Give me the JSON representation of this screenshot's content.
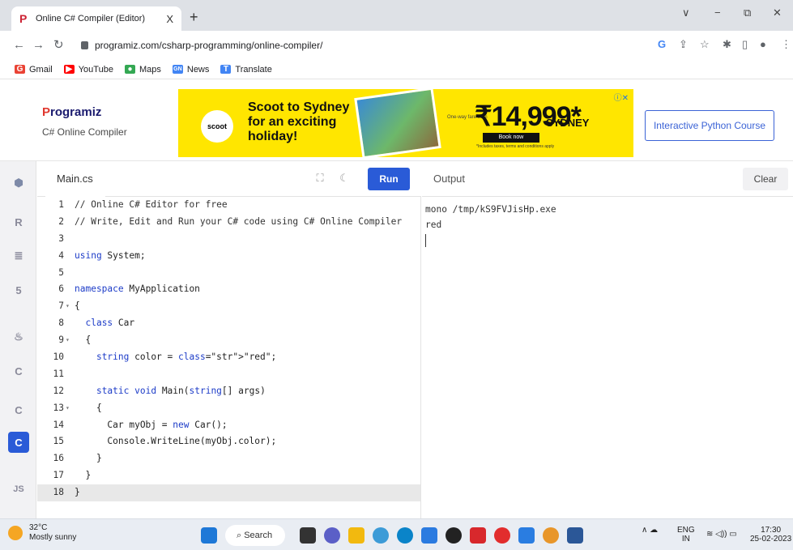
{
  "browser": {
    "tab_title": "Online C# Compiler (Editor)",
    "tab_close": "X",
    "new_tab": "+",
    "url": "programiz.com/csharp-programming/online-compiler/",
    "window_controls": [
      "∨",
      "−",
      "⧉",
      "✕"
    ]
  },
  "bookmarks": [
    {
      "label": "Gmail",
      "icon": "gmail-icon",
      "color": "#ea4335",
      "glyph": "G"
    },
    {
      "label": "YouTube",
      "icon": "youtube-icon",
      "color": "#ff0000",
      "glyph": "▶"
    },
    {
      "label": "Maps",
      "icon": "maps-icon",
      "color": "#34a853",
      "glyph": "●"
    },
    {
      "label": "News",
      "icon": "news-icon",
      "color": "#4285f4",
      "glyph": "GN"
    },
    {
      "label": "Translate",
      "icon": "translate-icon",
      "color": "#4285f4",
      "glyph": "T"
    }
  ],
  "header": {
    "logo": "rogramiz",
    "logo_mark": "P",
    "subtitle": "C# Online Compiler",
    "python_course_button": "Interactive Python Course"
  },
  "ad": {
    "brand": "scoot",
    "headline": "Scoot to Sydney for an exciting holiday!",
    "one_way": "One-way fare from",
    "price": "₹14,999*",
    "book_now": "Book now",
    "fine_print": "*Includes taxes, terms and conditions apply",
    "destination": "SYDNEY"
  },
  "sidebar": {
    "items": [
      "python-icon",
      "r-icon",
      "sql-icon",
      "html-icon",
      "java-icon",
      "c-icon",
      "cpp-icon",
      "csharp-icon",
      "js-icon"
    ],
    "js_label": "JS",
    "active": "csharp-icon"
  },
  "editor": {
    "file_name": "Main.cs",
    "run_label": "Run",
    "lines": [
      {
        "n": "1",
        "fold": "",
        "text": "// Online C# Editor for free"
      },
      {
        "n": "2",
        "fold": "",
        "text": "// Write, Edit and Run your C# code using C# Online Compiler"
      },
      {
        "n": "3",
        "fold": "",
        "text": ""
      },
      {
        "n": "4",
        "fold": "",
        "text": "using System;"
      },
      {
        "n": "5",
        "fold": "",
        "text": ""
      },
      {
        "n": "6",
        "fold": "",
        "text": "namespace MyApplication"
      },
      {
        "n": "7",
        "fold": "▾",
        "text": "{"
      },
      {
        "n": "8",
        "fold": "",
        "text": "  class Car"
      },
      {
        "n": "9",
        "fold": "▾",
        "text": "  {"
      },
      {
        "n": "10",
        "fold": "",
        "text": "    string color = \"red\";"
      },
      {
        "n": "11",
        "fold": "",
        "text": ""
      },
      {
        "n": "12",
        "fold": "",
        "text": "    static void Main(string[] args)"
      },
      {
        "n": "13",
        "fold": "▾",
        "text": "    {"
      },
      {
        "n": "14",
        "fold": "",
        "text": "      Car myObj = new Car();"
      },
      {
        "n": "15",
        "fold": "",
        "text": "      Console.WriteLine(myObj.color);"
      },
      {
        "n": "16",
        "fold": "",
        "text": "    }"
      },
      {
        "n": "17",
        "fold": "",
        "text": "  }"
      },
      {
        "n": "18",
        "fold": "",
        "text": "}"
      }
    ]
  },
  "output": {
    "label": "Output",
    "clear_label": "Clear",
    "lines": [
      "mono /tmp/kS9FVJisHp.exe",
      "red"
    ]
  },
  "taskbar": {
    "temperature": "32°C",
    "weather": "Mostly sunny",
    "search": "Search",
    "lang": "ENG",
    "region": "IN",
    "time": "17:30",
    "date": "25-02-2023"
  },
  "colors": {
    "accent": "#2a5bd7",
    "keyword": "#1d3cc8",
    "string": "#1a8a1a"
  }
}
